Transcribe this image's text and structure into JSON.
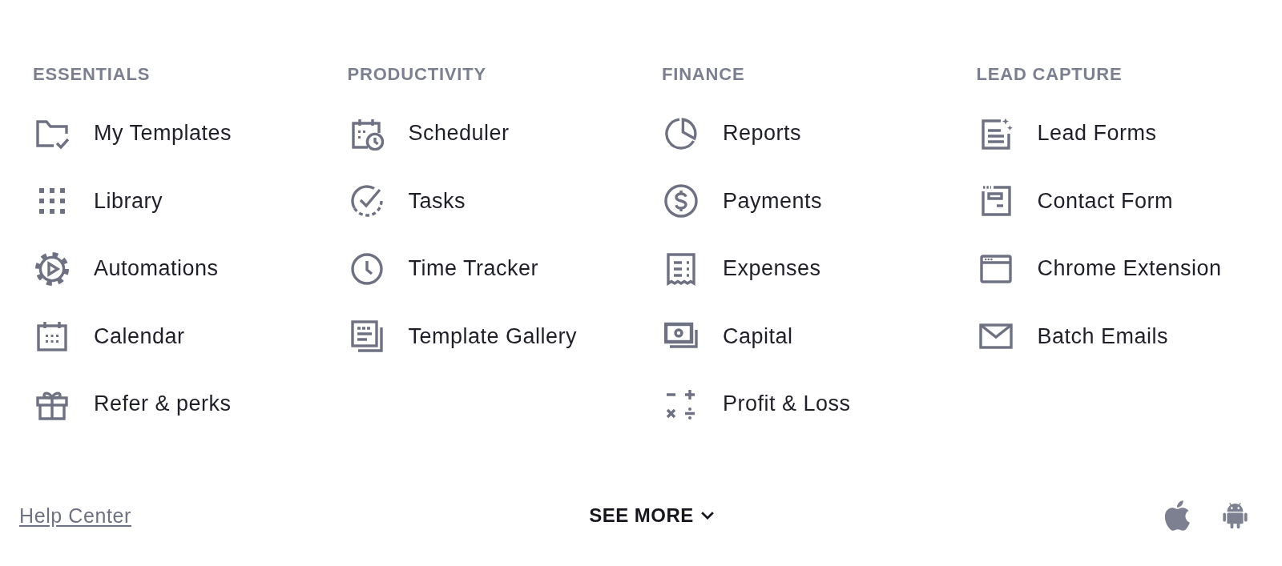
{
  "sections": [
    {
      "heading": "ESSENTIALS",
      "items": [
        "My Templates",
        "Library",
        "Automations",
        "Calendar",
        "Refer & perks"
      ]
    },
    {
      "heading": "PRODUCTIVITY",
      "items": [
        "Scheduler",
        "Tasks",
        "Time Tracker",
        "Template Gallery"
      ]
    },
    {
      "heading": "FINANCE",
      "items": [
        "Reports",
        "Payments",
        "Expenses",
        "Capital",
        "Profit & Loss"
      ]
    },
    {
      "heading": "LEAD CAPTURE",
      "items": [
        "Lead Forms",
        "Contact Form",
        "Chrome Extension",
        "Batch Emails"
      ]
    }
  ],
  "footer": {
    "help_link": "Help Center",
    "see_more": "SEE MORE"
  }
}
